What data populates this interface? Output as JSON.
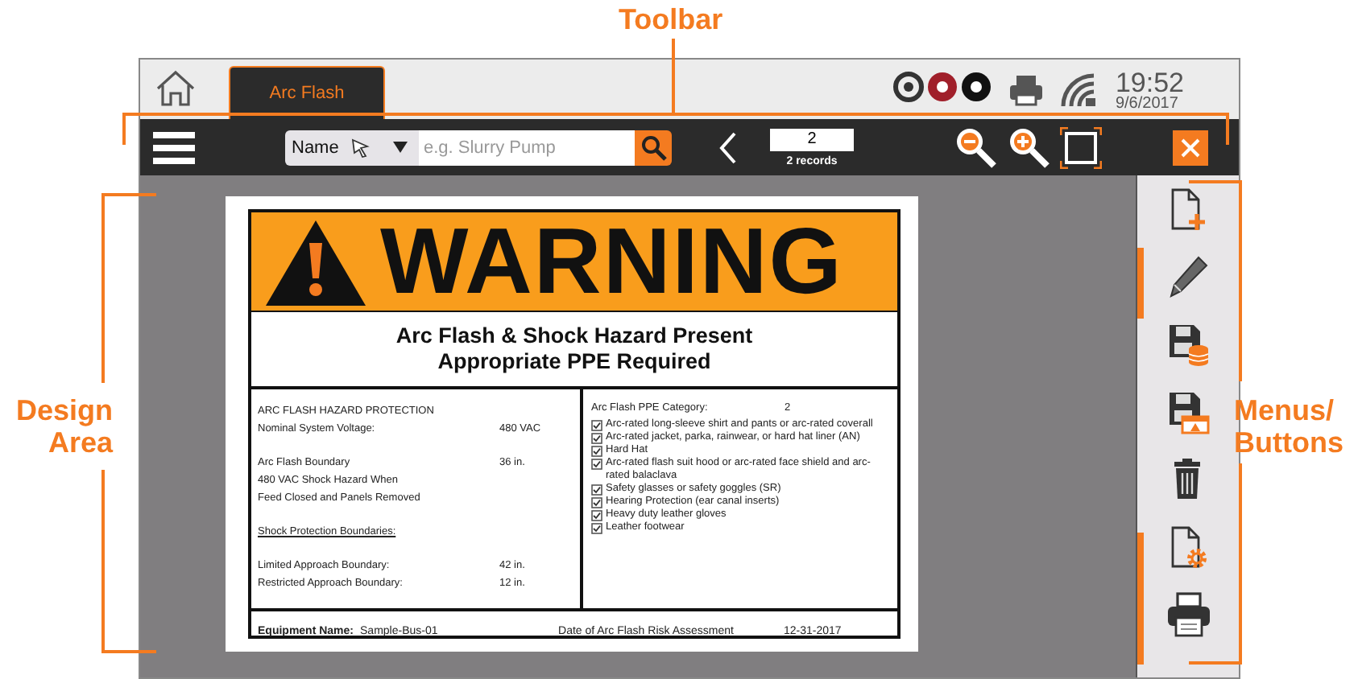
{
  "annotations": [
    {
      "kind": "toolbar",
      "text": "Toolbar"
    },
    {
      "kind": "design",
      "text": "Design Area"
    },
    {
      "kind": "menus",
      "text": "Menus/ Buttons"
    }
  ],
  "top_bar": {
    "tabs": [
      {
        "label": "Arc Flash",
        "selected": true
      }
    ],
    "clock": {
      "time": "19:52",
      "date": "9/6/2017"
    }
  },
  "toolbar": {
    "search": {
      "field": "Name",
      "placeholder": "e.g. Slurry Pump"
    },
    "record": {
      "value": "2",
      "caption": "2 records"
    }
  },
  "document": {
    "banner": "WARNING",
    "headline": [
      "Arc Flash & Shock Hazard Present",
      "Appropriate PPE Required"
    ],
    "left_groups": [
      [
        {
          "kind": "text",
          "label": "ARC FLASH HAZARD PROTECTION"
        },
        {
          "kind": "pair",
          "label": "Nominal System Voltage:",
          "value": "480 VAC"
        }
      ],
      [
        {
          "kind": "pair",
          "label": "Arc Flash Boundary",
          "value": "36 in."
        },
        {
          "kind": "text",
          "label": "480 VAC Shock Hazard When"
        },
        {
          "kind": "text",
          "label": "Feed Closed and Panels Removed"
        }
      ],
      [
        {
          "kind": "heading",
          "label": "Shock Protection Boundaries:"
        }
      ],
      [
        {
          "kind": "pair",
          "label": "Limited Approach Boundary:",
          "value": "42 in."
        },
        {
          "kind": "pair",
          "label": "Restricted Approach Boundary:",
          "value": "12 in."
        }
      ]
    ],
    "ppe": {
      "label": "Arc Flash PPE Category:",
      "value": "2"
    },
    "ppe_items": [
      {
        "text": "Arc-rated long-sleeve shirt and pants or arc-rated coverall",
        "checked": true
      },
      {
        "text": "Arc-rated jacket, parka, rainwear, or hard hat liner (AN)",
        "checked": true
      },
      {
        "text": "Hard Hat",
        "checked": true
      },
      {
        "text": "Arc-rated flash suit hood or arc-rated face shield and arc-rated balaclava",
        "checked": true
      },
      {
        "text": "Safety glasses or safety goggles (SR)",
        "checked": true
      },
      {
        "text": "Hearing Protection (ear canal inserts)",
        "checked": true
      },
      {
        "text": "Heavy duty leather gloves",
        "checked": true
      },
      {
        "text": "Leather footwear",
        "checked": true
      }
    ],
    "footer": {
      "equipment_label": "Equipment Name:",
      "equipment": "Sample-Bus-01",
      "date_label": "Date of Arc Flash Risk Assessment",
      "date": "12-31-2017"
    }
  }
}
